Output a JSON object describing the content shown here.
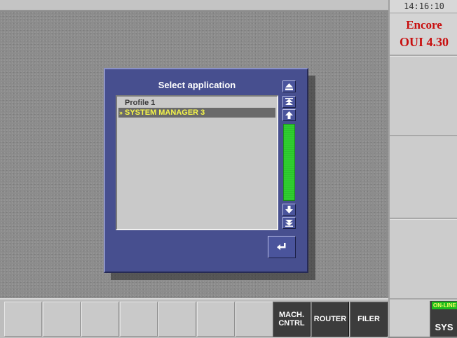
{
  "status": {
    "clock": "14:16:10",
    "online": "ON-LINE"
  },
  "brand": {
    "line1": "Encore",
    "line2": "OUI 4.30",
    "color": "#c80f0f"
  },
  "dialog": {
    "title": "Select application",
    "items": [
      {
        "label": "Profile 1",
        "selected": false
      },
      {
        "label": "SYSTEM MANAGER 3",
        "selected": true
      }
    ],
    "scroll_icons": [
      "eject-icon",
      "double-up-icon",
      "up-arrow-icon",
      "down-arrow-icon",
      "double-down-icon"
    ],
    "enter_icon": "enter-icon",
    "accent": "#474f8f",
    "scroll_track_color": "#2fcf2f"
  },
  "bottom_bar": {
    "buttons": [
      {
        "label": "MACH.\nCNTRL"
      },
      {
        "label": "ROUTER"
      },
      {
        "label": "FILER"
      }
    ],
    "sys_label": "SYS"
  }
}
